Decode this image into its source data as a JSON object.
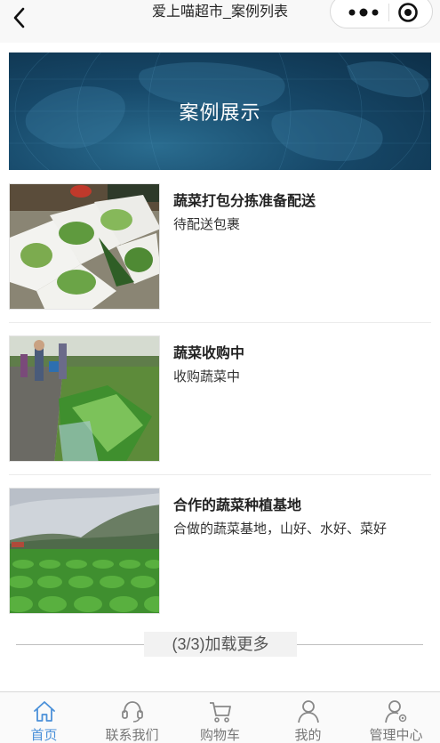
{
  "navbar": {
    "title": "爱上喵超市_案例列表",
    "back_icon": "chevron-left-icon",
    "more_icon": "more-dots-icon",
    "close_icon": "target-circle-icon"
  },
  "banner": {
    "title": "案例展示"
  },
  "cases": [
    {
      "title": "蔬菜打包分拣准备配送",
      "desc": "待配送包裹",
      "image": "vegetables-in-foam-boxes"
    },
    {
      "title": "蔬菜收购中",
      "desc": "收购蔬菜中",
      "image": "vegetable-harvest-field"
    },
    {
      "title": "合作的蔬菜种植基地",
      "desc": "合做的蔬菜基地，山好、水好、菜好",
      "image": "vegetable-farm-mountains"
    }
  ],
  "load_more": {
    "label": "(3/3)加载更多"
  },
  "tabbar": {
    "items": [
      {
        "label": "首页",
        "icon": "home-icon",
        "active": true
      },
      {
        "label": "联系我们",
        "icon": "headset-icon",
        "active": false
      },
      {
        "label": "购物车",
        "icon": "cart-icon",
        "active": false
      },
      {
        "label": "我的",
        "icon": "user-icon",
        "active": false
      },
      {
        "label": "管理中心",
        "icon": "user-settings-icon",
        "active": false
      }
    ],
    "active_color": "#4a90d9",
    "inactive_color": "#777777"
  }
}
